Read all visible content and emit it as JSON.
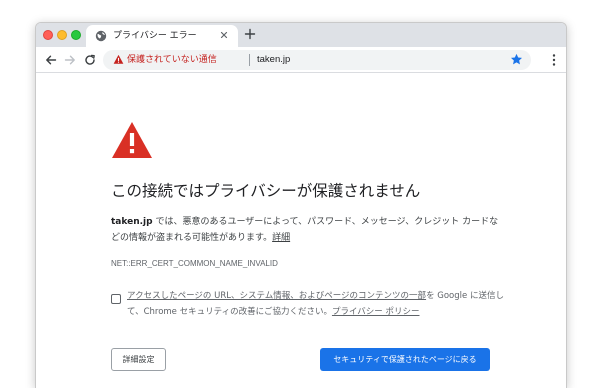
{
  "colors": {
    "accent": "#1a73e8",
    "warning_red": "#c5221f",
    "danger_icon": "#d93025",
    "star": "#1a73e8"
  },
  "tab": {
    "title": "プライバシー エラー",
    "favicon": "globe-icon"
  },
  "toolbar": {
    "security_label": "保護されていない通信",
    "url": "taken.jp"
  },
  "page": {
    "heading": "この接続ではプライバシーが保護されません",
    "explanation_host": "taken.jp",
    "explanation_text": " では、悪意のあるユーザーによって、パスワード、メッセージ、クレジット カードなどの情報が盗まれる可能性があります。",
    "details_link": "詳細",
    "error_code": "NET::ERR_CERT_COMMON_NAME_INVALID",
    "optin_part1": "アクセスしたページの URL、システム情報、およびページのコンテンツの一部",
    "optin_part2": "を Google に送信して、Chrome セキュリティの改善にご協力ください。",
    "privacy_policy_link": "プライバシー ポリシー",
    "optin_checked": false,
    "details_button": "詳細設定",
    "back_button": "セキュリティで保護されたページに戻る"
  }
}
